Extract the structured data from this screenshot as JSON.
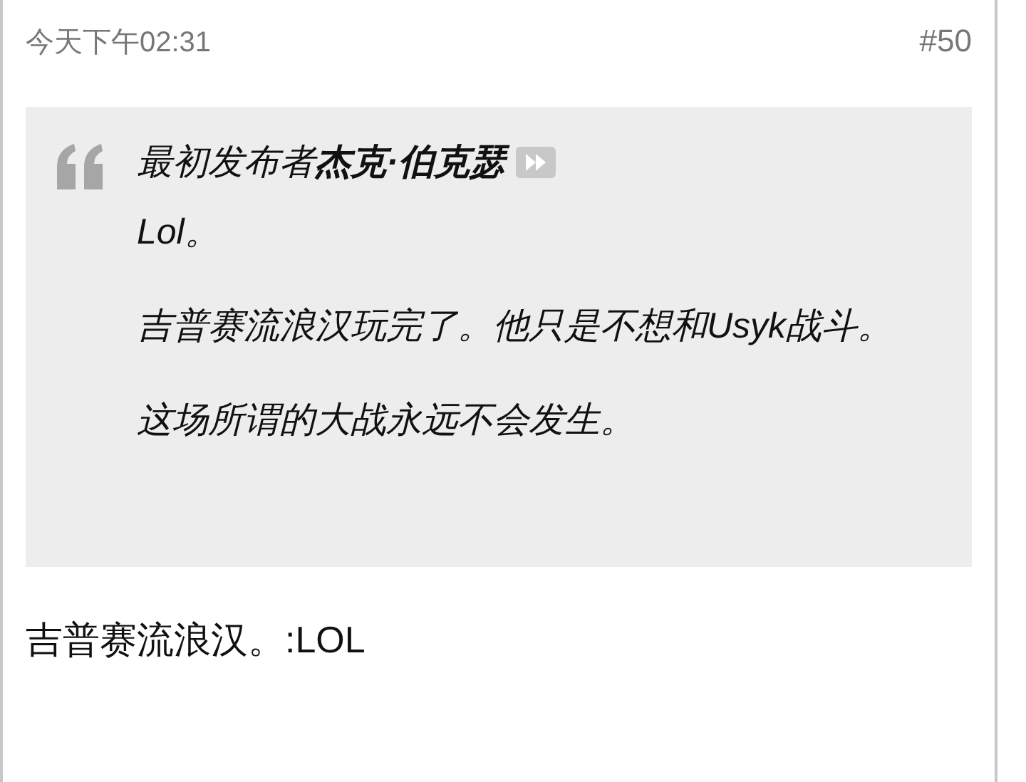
{
  "post": {
    "timestamp": "今天下午02:31",
    "number": "#50",
    "quote": {
      "attribution": "最初发布者**杰克·伯克瑟**",
      "paragraphs": [
        "Lol。",
        "吉普赛流浪汉玩完了。他只是不想和Usyk战斗。",
        "这场所谓的大战永远不会发生。"
      ]
    },
    "reply": "吉普赛流浪汉。:LOL"
  }
}
